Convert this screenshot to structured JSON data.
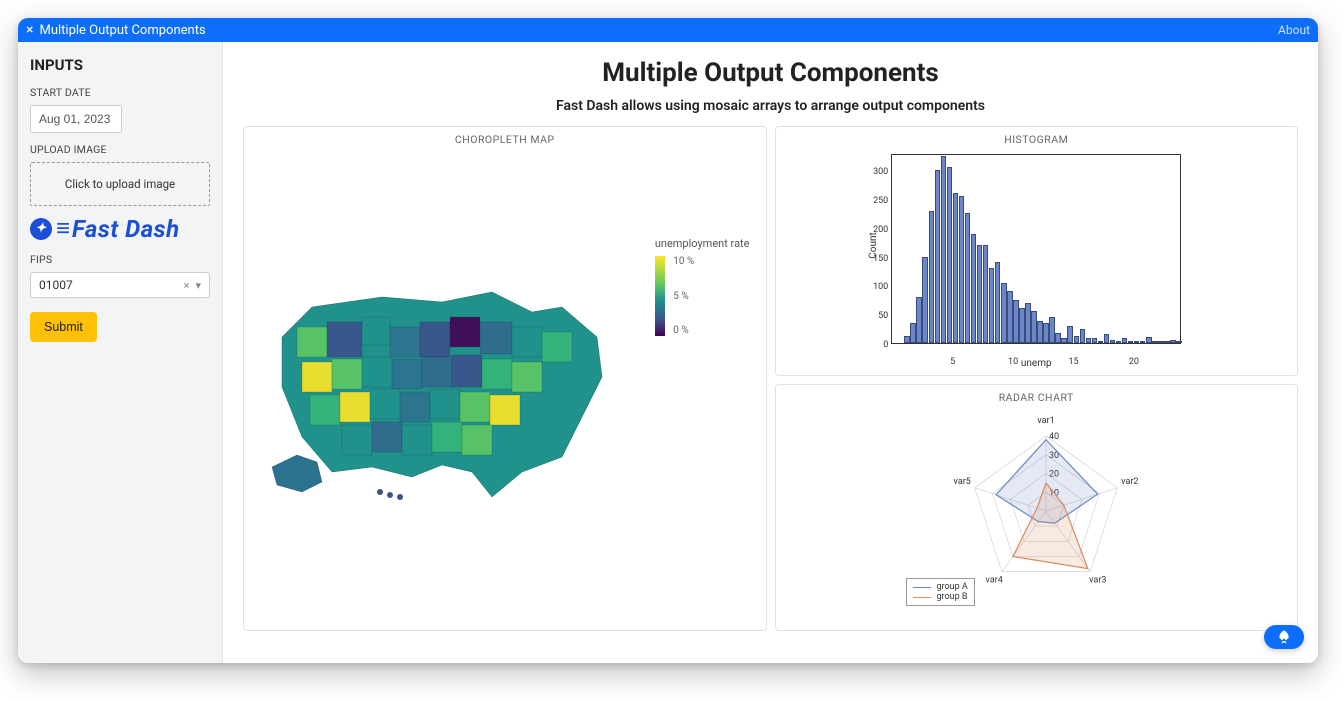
{
  "topbar": {
    "title": "Multiple Output Components",
    "about": "About"
  },
  "sidebar": {
    "heading": "INPUTS",
    "start_date_label": "START DATE",
    "start_date_value": "Aug 01, 2023",
    "upload_label": "UPLOAD IMAGE",
    "upload_text": "Click to upload image",
    "brand_text": "Fast Dash",
    "fips_label": "FIPS",
    "fips_value": "01007",
    "submit_label": "Submit"
  },
  "main": {
    "title": "Multiple Output Components",
    "subtitle": "Fast Dash allows using mosaic arrays to arrange output components"
  },
  "panels": {
    "choropleth_title": "CHOROPLETH MAP",
    "histogram_title": "HISTOGRAM",
    "radar_title": "RADAR CHART"
  },
  "choropleth_legend": {
    "title": "unemployment rate",
    "ticks": [
      "10 %",
      "5 %",
      "0 %"
    ]
  },
  "radar_legend": {
    "a": "group A",
    "b": "group B"
  },
  "radar_vars": [
    "var1",
    "var2",
    "var3",
    "var4",
    "var5"
  ],
  "chart_data": [
    {
      "type": "choropleth",
      "title": "CHOROPLETH MAP",
      "color_metric": "unemployment rate",
      "colorbar_ticks": [
        0,
        5,
        10
      ],
      "colorbar_unit": "%",
      "geography": "US counties"
    },
    {
      "type": "bar",
      "title": "HISTOGRAM",
      "xlabel": "unemp",
      "ylabel": "Count",
      "xlim": [
        0,
        24
      ],
      "ylim": [
        0,
        330
      ],
      "xticks": [
        5,
        10,
        15,
        20
      ],
      "yticks": [
        0,
        50,
        100,
        150,
        200,
        250,
        300
      ],
      "bin_width": 0.5,
      "categories": [
        1.0,
        1.5,
        2.0,
        2.5,
        3.0,
        3.5,
        4.0,
        4.5,
        5.0,
        5.5,
        6.0,
        6.5,
        7.0,
        7.5,
        8.0,
        8.5,
        9.0,
        9.5,
        10.0,
        10.5,
        11.0,
        11.5,
        12.0,
        12.5,
        13.0,
        13.5,
        14.0,
        14.5,
        15.0,
        15.5,
        16.0,
        16.5,
        17.0,
        17.5,
        18.0,
        18.5,
        19.0,
        19.5,
        20.0,
        20.5,
        21.0,
        21.5,
        22.0,
        22.5,
        23.0,
        23.5
      ],
      "values": [
        12,
        35,
        80,
        150,
        230,
        300,
        325,
        305,
        260,
        255,
        225,
        190,
        170,
        170,
        130,
        140,
        105,
        90,
        75,
        60,
        70,
        55,
        38,
        35,
        45,
        18,
        8,
        30,
        12,
        25,
        8,
        8,
        2,
        15,
        6,
        2,
        8,
        3,
        3,
        2,
        10,
        3,
        2,
        2,
        5,
        2
      ]
    },
    {
      "type": "radar",
      "title": "RADAR CHART",
      "categories": [
        "var1",
        "var2",
        "var3",
        "var4",
        "var5"
      ],
      "range": [
        0,
        40
      ],
      "rings": [
        10,
        20,
        30,
        40
      ],
      "series": [
        {
          "name": "group A",
          "color": "#6b87c7",
          "values": [
            38,
            29,
            8,
            7,
            28
          ]
        },
        {
          "name": "group B",
          "color": "#d98b5f",
          "values": [
            15,
            10,
            38,
            30,
            5
          ]
        }
      ]
    }
  ]
}
